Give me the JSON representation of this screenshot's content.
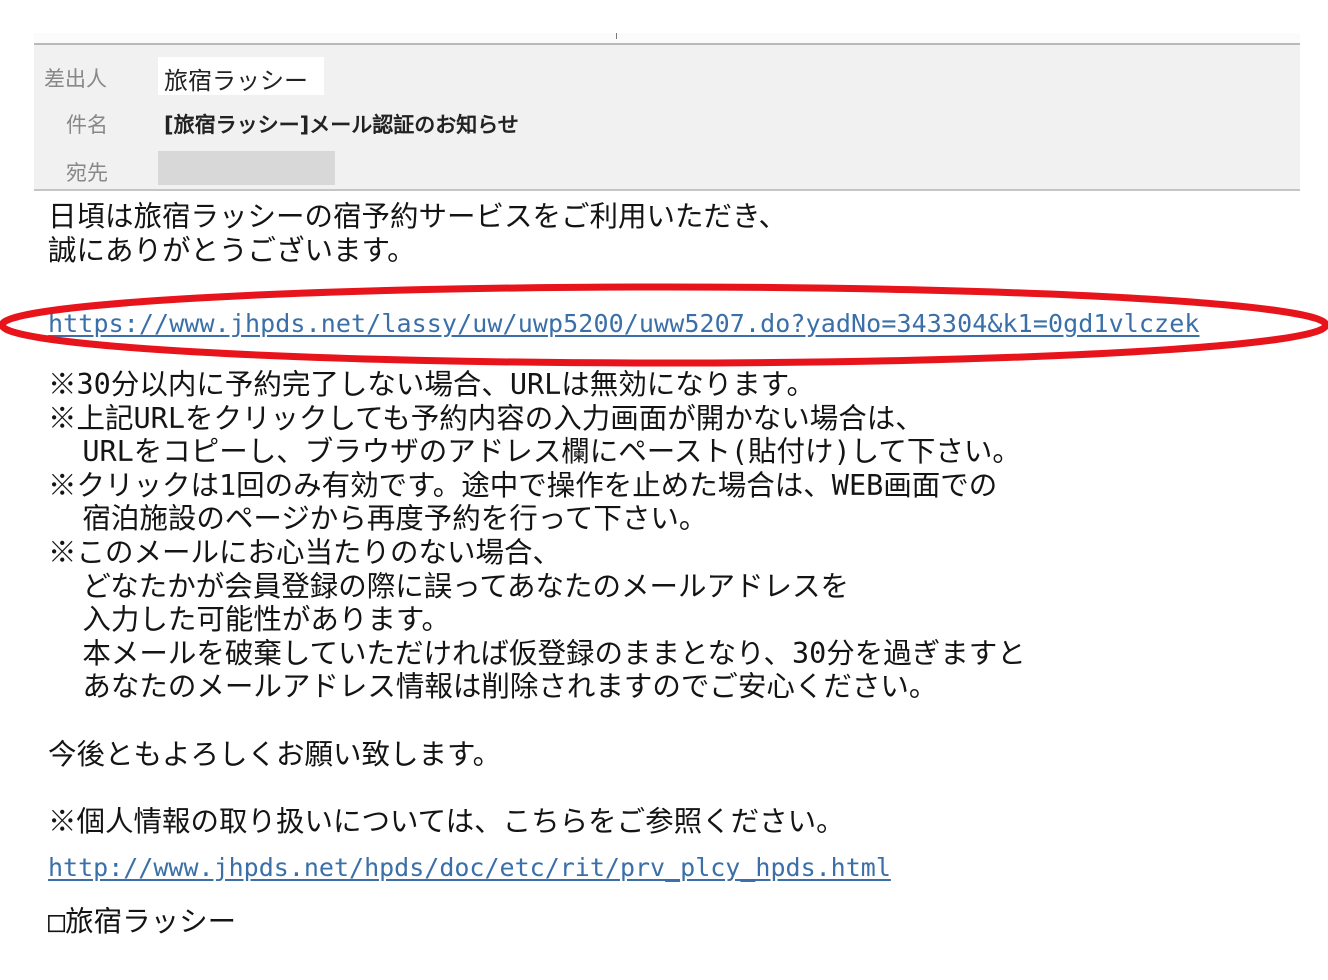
{
  "header": {
    "from_label": "差出人",
    "from_value": "旅宿ラッシー",
    "subject_label": "件名",
    "subject_value": "[旅宿ラッシー]メール認証のお知らせ",
    "to_label": "宛先"
  },
  "body": {
    "greeting_1": "日頃は旅宿ラッシーの宿予約サービスをご利用いただき、",
    "greeting_2": "誠にありがとうございます。",
    "auth_link": "https://www.jhpds.net/lassy/uw/uwp5200/uww5207.do?yadNo=343304&k1=0gd1vlczek",
    "notes": [
      "※30分以内に予約完了しない場合、URLは無効になります。",
      "※上記URLをクリックしても予約内容の入力画面が開かない場合は、",
      "  URLをコピーし、ブラウザのアドレス欄にペースト(貼付け)して下さい。",
      "※クリックは1回のみ有効です。途中で操作を止めた場合は、WEB画面での",
      "  宿泊施設のページから再度予約を行って下さい。",
      "※このメールにお心当たりのない場合、",
      "  どなたかが会員登録の際に誤ってあなたのメールアドレスを",
      "  入力した可能性があります。",
      "  本メールを破棄していただければ仮登録のままとなり、30分を過ぎますと",
      "  あなたのメールアドレス情報は削除されますのでご安心ください。"
    ],
    "closing": "今後ともよろしくお願い致します。",
    "privacy_note": "※個人情報の取り扱いについては、こちらをご参照ください。",
    "privacy_link": "http://www.jhpds.net/hpds/doc/etc/rit/prv_plcy_hpds.html",
    "signature": "□旅宿ラッシー"
  },
  "colors": {
    "link": "#3a6fa8",
    "annotation_ellipse": "#e8141c",
    "header_bg": "#f1f1f1",
    "label_gray": "#888888"
  }
}
